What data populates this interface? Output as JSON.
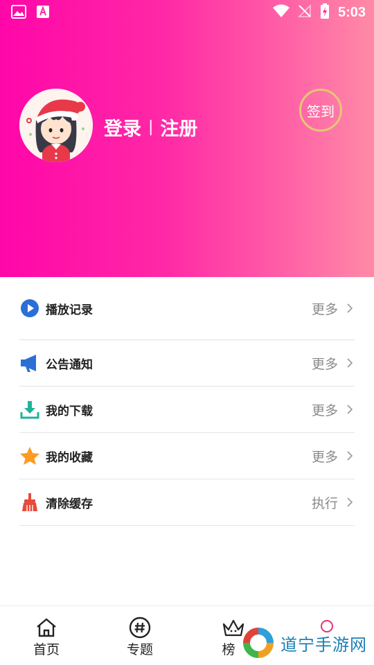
{
  "status_bar": {
    "time": "5:03",
    "icons": [
      "image-icon",
      "text-icon",
      "wifi-icon",
      "no-signal-icon",
      "battery-charging-icon"
    ]
  },
  "profile": {
    "login_label": "登录",
    "separator": "|",
    "register_label": "注册",
    "signin_label": "签到"
  },
  "menu": {
    "items": [
      {
        "label": "播放记录",
        "more": "更多",
        "icon": "play-icon",
        "color": "#2a6fd6"
      },
      {
        "label": "公告通知",
        "more": "更多",
        "icon": "megaphone-icon",
        "color": "#2a6fd6"
      },
      {
        "label": "我的下载",
        "more": "更多",
        "icon": "download-icon",
        "color": "#1fb39a"
      },
      {
        "label": "我的收藏",
        "more": "更多",
        "icon": "star-icon",
        "color": "#ff9a1f"
      },
      {
        "label": "清除缓存",
        "more": "执行",
        "icon": "broom-icon",
        "color": "#e84a3c"
      }
    ]
  },
  "tabs": [
    {
      "label": "首页",
      "icon": "home-icon"
    },
    {
      "label": "专题",
      "icon": "hashtag-icon"
    },
    {
      "label": "榜",
      "icon": "crown-icon"
    },
    {
      "label": "",
      "icon": "profile-icon"
    }
  ],
  "watermark": {
    "text": "道宁手游网"
  },
  "colors": {
    "header_gradient_start": "#ff06a8",
    "header_gradient_end": "#ff8aa6",
    "signin_border": "#e4c776",
    "active_tab": "#e8326f"
  }
}
